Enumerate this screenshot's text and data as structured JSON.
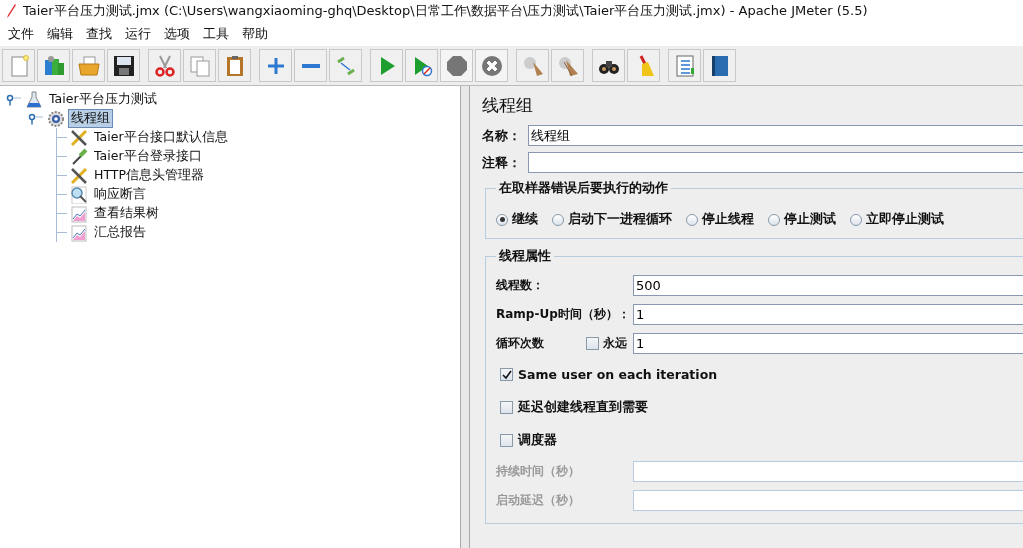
{
  "window": {
    "title": "Taier平台压力测试.jmx (C:\\Users\\wangxiaoming-ghq\\Desktop\\日常工作\\数据平台\\压力测试\\Taier平台压力测试.jmx) - Apache JMeter (5.5)"
  },
  "menu": [
    "文件",
    "编辑",
    "查找",
    "运行",
    "选项",
    "工具",
    "帮助"
  ],
  "toolbar": [
    [
      {
        "kind": "new",
        "disabled": false
      },
      {
        "kind": "templates",
        "disabled": false
      },
      {
        "kind": "open",
        "disabled": false
      },
      {
        "kind": "save",
        "disabled": false
      }
    ],
    [
      {
        "kind": "cut",
        "disabled": false
      },
      {
        "kind": "copy",
        "disabled": false
      },
      {
        "kind": "paste",
        "disabled": false
      }
    ],
    [
      {
        "kind": "expand",
        "disabled": false
      },
      {
        "kind": "collapse",
        "disabled": false
      },
      {
        "kind": "toggle",
        "disabled": false
      }
    ],
    [
      {
        "kind": "start",
        "disabled": false
      },
      {
        "kind": "start_no_pause",
        "disabled": false
      },
      {
        "kind": "stop",
        "disabled": true
      },
      {
        "kind": "shutdown",
        "disabled": true
      }
    ],
    [
      {
        "kind": "clear",
        "disabled": false
      },
      {
        "kind": "clear_all",
        "disabled": false
      }
    ],
    [
      {
        "kind": "search",
        "disabled": false
      },
      {
        "kind": "reset_search",
        "disabled": false
      }
    ],
    [
      {
        "kind": "function_helper",
        "disabled": false
      },
      {
        "kind": "help",
        "disabled": false
      }
    ]
  ],
  "tree": [
    {
      "label": "Taier平台压力测试",
      "kind": "test_plan",
      "selected": false,
      "expanded": true,
      "children": [
        {
          "label": "线程组",
          "kind": "thread_group",
          "selected": true,
          "expanded": true,
          "children": [
            {
              "label": "Taier平台接口默认信息",
              "kind": "config",
              "selected": false
            },
            {
              "label": "Taier平台登录接口",
              "kind": "sampler",
              "selected": false
            },
            {
              "label": "HTTP信息头管理器",
              "kind": "config",
              "selected": false
            },
            {
              "label": "响应断言",
              "kind": "assertion",
              "selected": false
            },
            {
              "label": "查看结果树",
              "kind": "listener",
              "selected": false
            },
            {
              "label": "汇总报告",
              "kind": "listener",
              "selected": false
            }
          ]
        }
      ]
    }
  ],
  "panel": {
    "title": "线程组",
    "name_field": {
      "label": "名称：",
      "value": "线程组"
    },
    "comment_field": {
      "label": "注释："
    },
    "on_error": {
      "legend": "在取样器错误后要执行的动作",
      "options": [
        {
          "label": "继续",
          "selected": true
        },
        {
          "label": "启动下一进程循环",
          "selected": false
        },
        {
          "label": "停止线程",
          "selected": false
        },
        {
          "label": "停止测试",
          "selected": false
        },
        {
          "label": "立即停止测试",
          "selected": false
        }
      ]
    },
    "thread_properties": {
      "legend": "线程属性",
      "rows": [
        {
          "kind": "field",
          "label": "线程数：",
          "value": "500",
          "disabled": false
        },
        {
          "kind": "field",
          "label": "Ramp-Up时间（秒）：",
          "value": "1",
          "disabled": false
        },
        {
          "kind": "loop",
          "label": "循环次数",
          "checkbox": {
            "label": "永远",
            "checked": false
          },
          "value": "1",
          "disabled": false
        },
        {
          "kind": "checkbox",
          "label": "Same user on each iteration",
          "checked": true
        },
        {
          "kind": "checkbox",
          "label": "延迟创建线程直到需要",
          "checked": false
        },
        {
          "kind": "checkbox",
          "label": "调度器",
          "checked": false
        },
        {
          "kind": "field",
          "label": "持续时间（秒）",
          "disabled": true
        },
        {
          "kind": "field",
          "label": "启动延迟（秒）",
          "disabled": true
        }
      ]
    }
  }
}
